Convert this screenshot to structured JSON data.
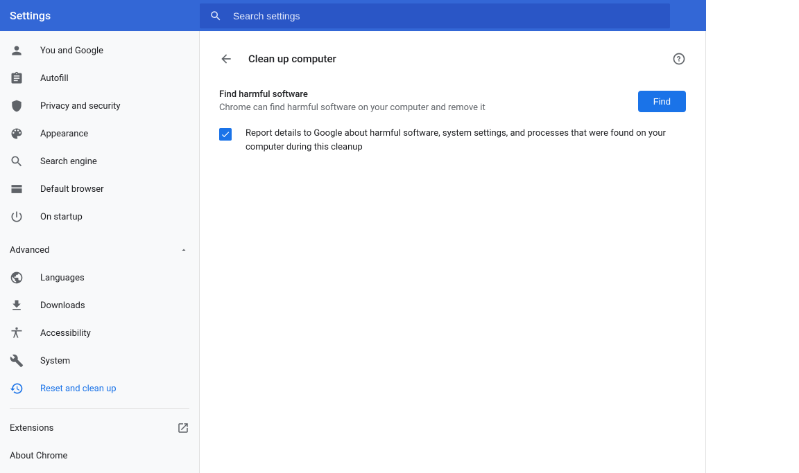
{
  "header": {
    "app_title": "Settings",
    "search_placeholder": "Search settings"
  },
  "sidebar": {
    "main_items": [
      {
        "id": "you-and-google",
        "label": "You and Google",
        "icon": "person"
      },
      {
        "id": "autofill",
        "label": "Autofill",
        "icon": "clipboard"
      },
      {
        "id": "privacy-and-security",
        "label": "Privacy and security",
        "icon": "shield"
      },
      {
        "id": "appearance",
        "label": "Appearance",
        "icon": "palette"
      },
      {
        "id": "search-engine",
        "label": "Search engine",
        "icon": "search"
      },
      {
        "id": "default-browser",
        "label": "Default browser",
        "icon": "browser"
      },
      {
        "id": "on-startup",
        "label": "On startup",
        "icon": "power"
      }
    ],
    "advanced_label": "Advanced",
    "advanced_items": [
      {
        "id": "languages",
        "label": "Languages",
        "icon": "globe"
      },
      {
        "id": "downloads",
        "label": "Downloads",
        "icon": "download"
      },
      {
        "id": "accessibility",
        "label": "Accessibility",
        "icon": "accessibility"
      },
      {
        "id": "system",
        "label": "System",
        "icon": "wrench"
      },
      {
        "id": "reset-and-clean-up",
        "label": "Reset and clean up",
        "icon": "history",
        "active": true
      }
    ],
    "footer": {
      "extensions_label": "Extensions",
      "about_label": "About Chrome"
    }
  },
  "main": {
    "page_title": "Clean up computer",
    "find_section": {
      "title": "Find harmful software",
      "subtitle": "Chrome can find harmful software on your computer and remove it",
      "button_label": "Find"
    },
    "report_checkbox": {
      "checked": true,
      "label": "Report details to Google about harmful software, system settings, and processes that were found on your computer during this cleanup"
    }
  }
}
